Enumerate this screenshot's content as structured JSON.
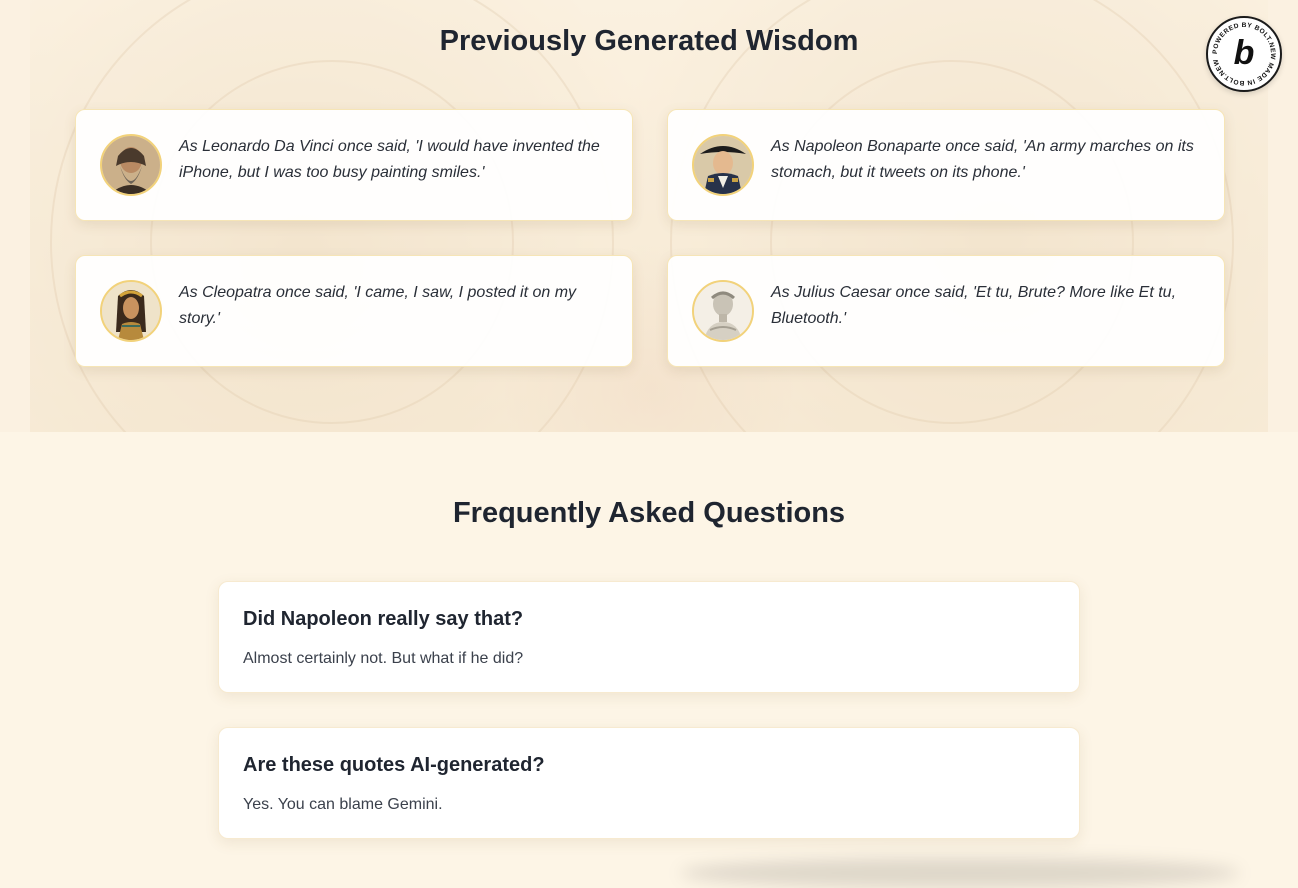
{
  "wisdom": {
    "title": "Previously Generated Wisdom",
    "quotes": [
      {
        "figure": "Leonardo Da Vinci",
        "text": "As Leonardo Da Vinci once said, 'I would have invented the iPhone, but I was too busy painting smiles.'"
      },
      {
        "figure": "Napoleon Bonaparte",
        "text": "As Napoleon Bonaparte once said, 'An army marches on its stomach, but it tweets on its phone.'"
      },
      {
        "figure": "Cleopatra",
        "text": "As Cleopatra once said, 'I came, I saw, I posted it on my story.'"
      },
      {
        "figure": "Julius Caesar",
        "text": "As Julius Caesar once said, 'Et tu, Brute? More like Et tu, Bluetooth.'"
      }
    ]
  },
  "faq": {
    "title": "Frequently Asked Questions",
    "items": [
      {
        "question": "Did Napoleon really say that?",
        "answer": "Almost certainly not. But what if he did?"
      },
      {
        "question": "Are these quotes AI-generated?",
        "answer": "Yes. You can blame Gemini."
      }
    ]
  },
  "badge": {
    "ring_text": "POWERED BY BOLT.NEW MADE IN BOLT.NEW",
    "letter": "b"
  },
  "colors": {
    "accent_border": "#f2d27a",
    "page_bg": "#fdf5e6",
    "heading": "#1f2530"
  }
}
